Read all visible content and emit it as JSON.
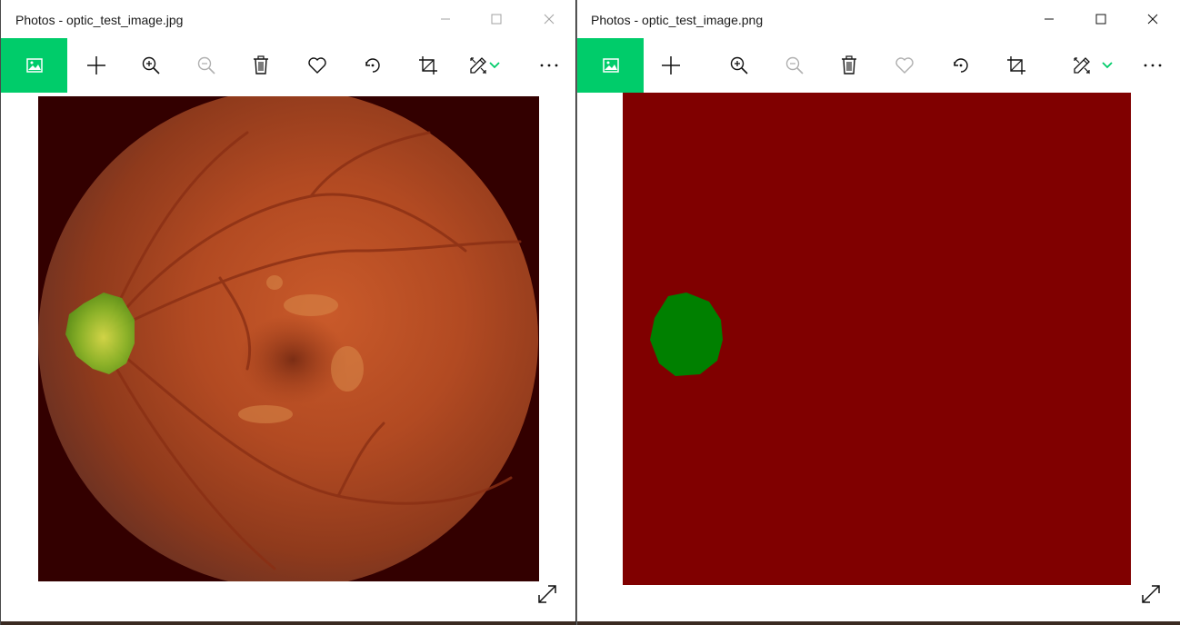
{
  "left_window": {
    "title": "Photos - optic_test_image.jpg",
    "file_name": "optic_test_image.jpg",
    "active": false
  },
  "right_window": {
    "title": "Photos - optic_test_image.png",
    "file_name": "optic_test_image.png",
    "active": true
  },
  "toolbar": {
    "items": [
      "view-photo-icon",
      "add-icon",
      "zoom-in-icon",
      "zoom-out-icon",
      "delete-icon",
      "favorite-icon",
      "rotate-icon",
      "crop-icon",
      "edit-icon",
      "chevron-down-icon",
      "more-icon"
    ]
  },
  "colors": {
    "accent": "#00cc6a",
    "mask_background": "#800000",
    "mask_region": "#008000",
    "fundus_border": "#330000",
    "overlay_green": "#6fae1f"
  }
}
